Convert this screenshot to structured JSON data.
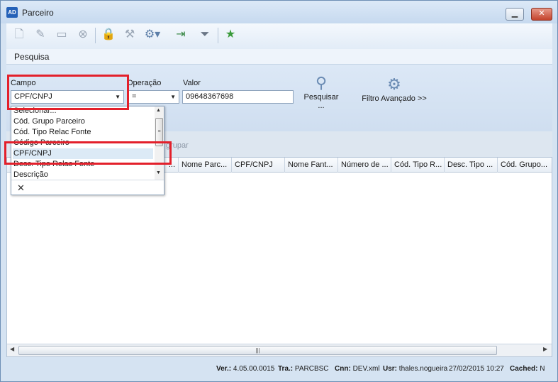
{
  "window": {
    "title": "Parceiro",
    "app_icon_text": "AD",
    "min_symbol": "▁",
    "close_symbol": "✕"
  },
  "toolbar": {
    "icons": [
      "new-icon",
      "edit-icon",
      "list-icon",
      "delete-icon",
      "lock-icon",
      "tools-icon",
      "settings-dropdown-icon",
      "export-icon",
      "filter-icon",
      "favorite-icon"
    ]
  },
  "search_section": {
    "title": "Pesquisa"
  },
  "filter": {
    "campo_label": "Campo",
    "campo_value": "CPF/CNPJ",
    "operacao_label": "Operação",
    "operacao_value": "=",
    "valor_label": "Valor",
    "valor_value": "09648367698",
    "pesquisar_label": "Pesquisar\n...",
    "filtro_avancado_label": "Filtro Avançado >>"
  },
  "dropdown": {
    "items": [
      "Selecionar...",
      "Cód. Grupo Parceiro",
      "Cód. Tipo Relac Fonte",
      "Código Parceiro",
      "CPF/CNPJ",
      "Desc. Tipo Relac Fonte",
      "Descrição"
    ],
    "selected_index": 4,
    "close_symbol": "✕"
  },
  "grid": {
    "group_hint": "grupar",
    "columns": [
      "...",
      "Nome Parc...",
      "CPF/CNPJ",
      "Nome Fant...",
      "Número de ...",
      "Cód. Tipo R...",
      "Desc. Tipo ...",
      "Cód. Grupo..."
    ]
  },
  "status": {
    "ver_label": "Ver.:",
    "ver_value": "4.05.00.0015",
    "tra_label": "Tra.:",
    "tra_value": "PARCBSC",
    "cnn_label": "Cnn:",
    "cnn_value": "DEV.xml",
    "usr_label": "Usr:",
    "usr_value": "thales.nogueira",
    "datetime": "27/02/2015 10:27",
    "cached_label": "Cached:",
    "cached_value": "N"
  },
  "colors": {
    "highlight_red": "#e3202b",
    "selection_blue": "#dceaf6"
  }
}
